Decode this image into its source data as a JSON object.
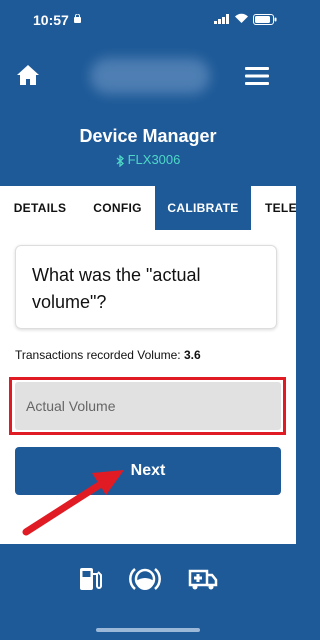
{
  "status_bar": {
    "time": "10:57"
  },
  "header": {
    "title": "Device Manager",
    "device_id": "FLX3006"
  },
  "tabs": [
    {
      "label": "DETAILS"
    },
    {
      "label": "CONFIG"
    },
    {
      "label": "CALIBRATE",
      "active": true
    },
    {
      "label": "TELE"
    }
  ],
  "question": {
    "text": "What was the \"actual volume\"?"
  },
  "recorded": {
    "label": "Transactions recorded Volume:",
    "value": "3.6"
  },
  "volume_input": {
    "placeholder": "Actual Volume",
    "value": ""
  },
  "next_button": {
    "label": "Next"
  },
  "colors": {
    "primary": "#1e5a98",
    "accent": "#4ed7c6",
    "highlight": "#e01b24"
  },
  "bottom_nav": [
    {
      "icon": "fuel-pump-icon"
    },
    {
      "icon": "tank-gauge-icon"
    },
    {
      "icon": "ambulance-icon"
    }
  ]
}
